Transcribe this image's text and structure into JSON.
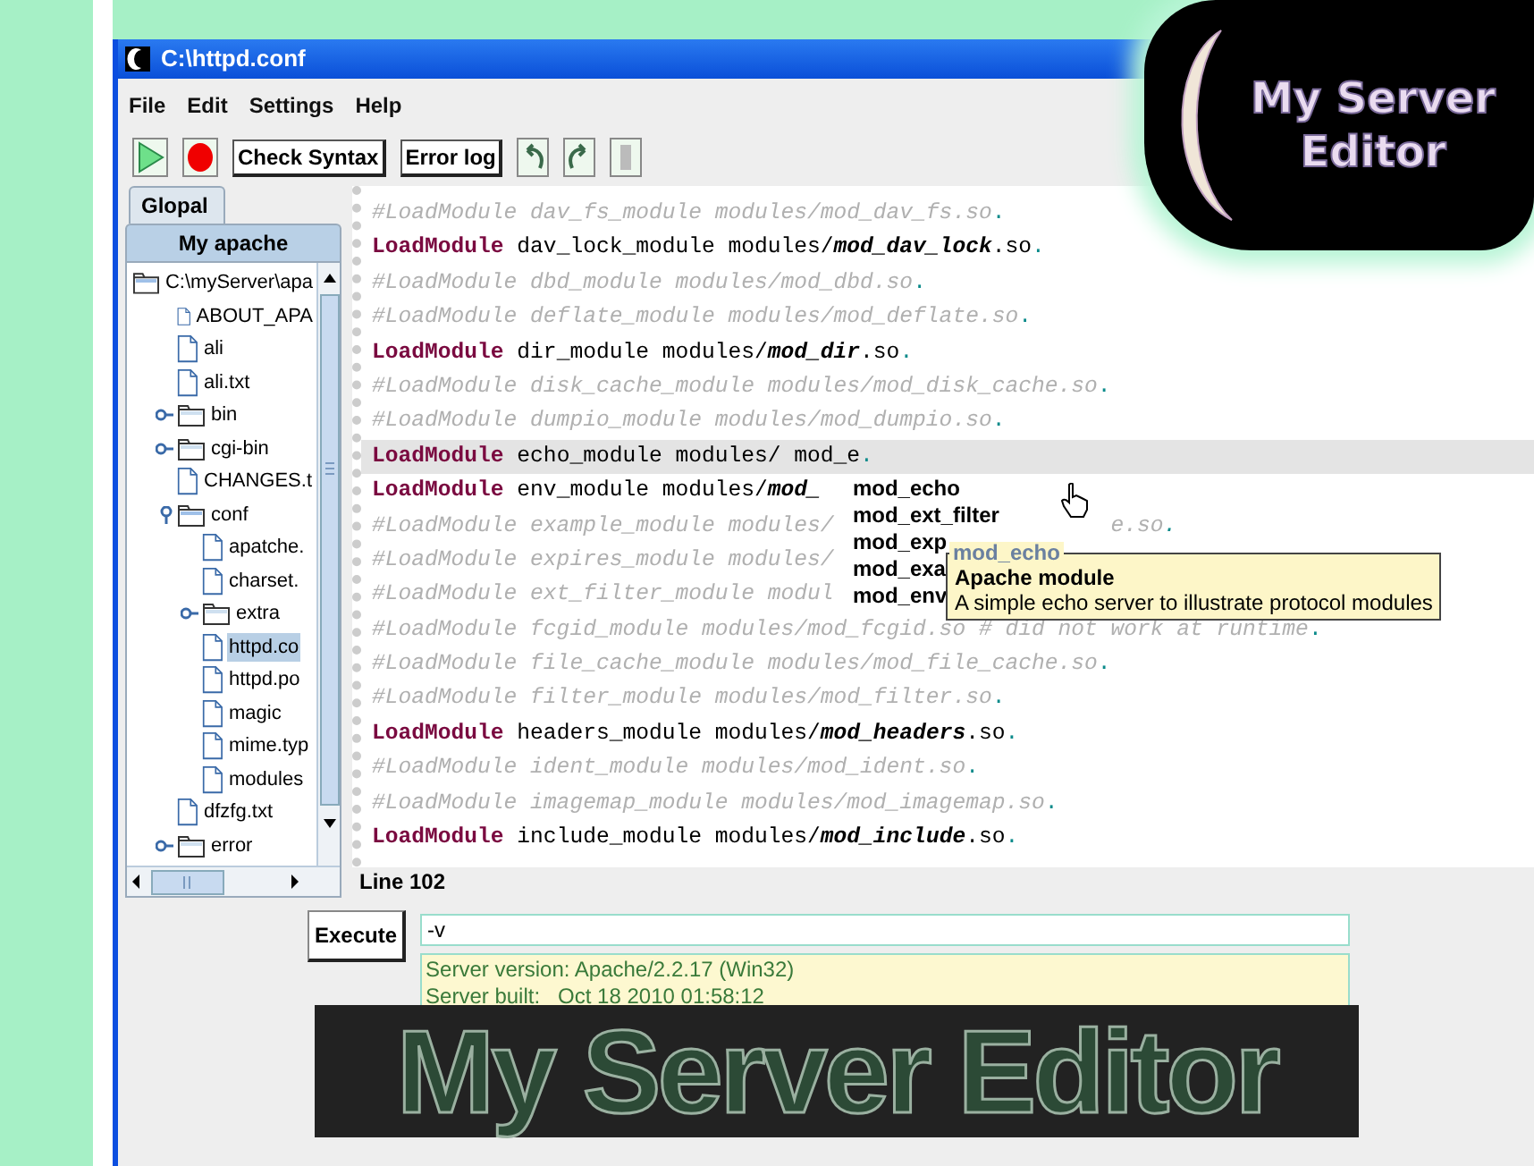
{
  "window": {
    "title": "C:\\httpd.conf"
  },
  "menu": [
    "File",
    "Edit",
    "Settings",
    "Help"
  ],
  "toolbar": {
    "buttons": [
      {
        "kind": "run"
      },
      {
        "kind": "stop"
      },
      {
        "kind": "text",
        "label": "Check Syntax"
      },
      {
        "kind": "text",
        "label": "Error log"
      },
      {
        "kind": "undo"
      },
      {
        "kind": "redo"
      },
      {
        "kind": "grip"
      }
    ]
  },
  "sidebar": {
    "tabs": [
      {
        "label": "Glopal",
        "selected": false
      },
      {
        "label": "My apache",
        "selected": true
      }
    ],
    "tree": [
      {
        "label": "C:\\myServer\\apa",
        "kind": "folder",
        "expanded": true,
        "selected": false,
        "children": [
          {
            "label": "ABOUT_APA",
            "kind": "file",
            "selected": false
          },
          {
            "label": "ali",
            "kind": "file",
            "selected": false
          },
          {
            "label": "ali.txt",
            "kind": "file",
            "selected": false
          },
          {
            "label": "bin",
            "kind": "folder",
            "expanded": false,
            "selected": false
          },
          {
            "label": "cgi-bin",
            "kind": "folder",
            "expanded": false,
            "selected": false
          },
          {
            "label": "CHANGES.t",
            "kind": "file",
            "selected": false
          },
          {
            "label": "conf",
            "kind": "folder",
            "expanded": true,
            "selected": false,
            "children": [
              {
                "label": "apatche.",
                "kind": "file",
                "selected": false
              },
              {
                "label": "charset.",
                "kind": "file",
                "selected": false
              },
              {
                "label": "extra",
                "kind": "folder",
                "expanded": false,
                "selected": false
              },
              {
                "label": "httpd.co",
                "kind": "file",
                "selected": true
              },
              {
                "label": "httpd.po",
                "kind": "file",
                "selected": false
              },
              {
                "label": "magic",
                "kind": "file",
                "selected": false
              },
              {
                "label": "mime.typ",
                "kind": "file",
                "selected": false
              },
              {
                "label": "modules",
                "kind": "file",
                "selected": false
              }
            ]
          },
          {
            "label": "dfzfg.txt",
            "kind": "file",
            "selected": false
          },
          {
            "label": "error",
            "kind": "folder",
            "expanded": false,
            "selected": false
          }
        ]
      }
    ]
  },
  "editor": {
    "lines": [
      {
        "kind": "comment",
        "text": "#LoadModule dav_fs_module modules/mod_dav_fs.so",
        "end": ".",
        "current": false
      },
      {
        "kind": "directive",
        "keyword": "LoadModule",
        "module": "dav_lock_module",
        "dir": "modules/",
        "file": "mod_dav_lock",
        "ext": ".so",
        "end": ".",
        "current": false
      },
      {
        "kind": "comment",
        "text": "#LoadModule dbd_module modules/mod_dbd.so",
        "end": ".",
        "current": false
      },
      {
        "kind": "comment",
        "text": "#LoadModule deflate_module modules/mod_deflate.so",
        "end": ".",
        "current": false
      },
      {
        "kind": "directive",
        "keyword": "LoadModule",
        "module": "dir_module",
        "dir": "modules/",
        "file": "mod_dir",
        "ext": ".so",
        "end": ".",
        "current": false
      },
      {
        "kind": "comment",
        "text": "#LoadModule disk_cache_module modules/mod_disk_cache.so",
        "end": ".",
        "current": false
      },
      {
        "kind": "comment",
        "text": "#LoadModule dumpio_module modules/mod_dumpio.so",
        "end": ".",
        "current": false
      },
      {
        "kind": "directive",
        "keyword": "LoadModule",
        "module": "echo_module",
        "dir": "modules/ mod_e",
        "end": ".",
        "current": true
      },
      {
        "kind": "directive",
        "keyword": "LoadModule",
        "module": "env_module",
        "dir": "modules/",
        "file": "mod_",
        "current": false
      },
      {
        "kind": "comment",
        "text": "#LoadModule example_module modules/",
        "tail": "e.so",
        "end": ".",
        "current": false
      },
      {
        "kind": "comment",
        "text": "#LoadModule expires_module modules/",
        "current": false
      },
      {
        "kind": "comment",
        "text": "#LoadModule ext_filter_module modul",
        "current": false
      },
      {
        "kind": "comment",
        "text": "#LoadModule fcgid_module modules/mod_fcgid.so # did not work at runtime",
        "end": ".",
        "current": false
      },
      {
        "kind": "comment",
        "text": "#LoadModule file_cache_module modules/mod_file_cache.so",
        "end": ".",
        "current": false
      },
      {
        "kind": "comment",
        "text": "#LoadModule filter_module modules/mod_filter.so",
        "end": ".",
        "current": false
      },
      {
        "kind": "directive",
        "keyword": "LoadModule",
        "module": "headers_module",
        "dir": "modules/",
        "file": "mod_headers",
        "ext": ".so",
        "end": ".",
        "current": false
      },
      {
        "kind": "comment",
        "text": "#LoadModule ident_module modules/mod_ident.so",
        "end": ".",
        "current": false
      },
      {
        "kind": "comment",
        "text": "#LoadModule imagemap_module modules/mod_imagemap.so",
        "end": ".",
        "current": false
      },
      {
        "kind": "directive",
        "keyword": "LoadModule",
        "module": "include_module",
        "dir": "modules/",
        "file": "mod_include",
        "ext": ".so",
        "end": ".",
        "current": false
      }
    ],
    "autocomplete": {
      "items": [
        {
          "label": "mod_echo"
        },
        {
          "label": "mod_ext_filter"
        },
        {
          "label": "mod_exp"
        },
        {
          "label": "mod_exa"
        },
        {
          "label": "mod_env"
        }
      ],
      "tooltip": {
        "title": "mod_echo",
        "heading": "Apache module",
        "description": "A simple echo server to illustrate protocol modules"
      }
    }
  },
  "status_bar": "Line 102",
  "command": {
    "button": "Execute",
    "value": "-v"
  },
  "output": [
    "Server version: Apache/2.2.17 (Win32)",
    "Server built:   Oct 18 2010 01:58:12"
  ],
  "logo": {
    "lines": [
      "My Server",
      "Editor"
    ]
  },
  "banner": {
    "text": "My Server Editor"
  }
}
